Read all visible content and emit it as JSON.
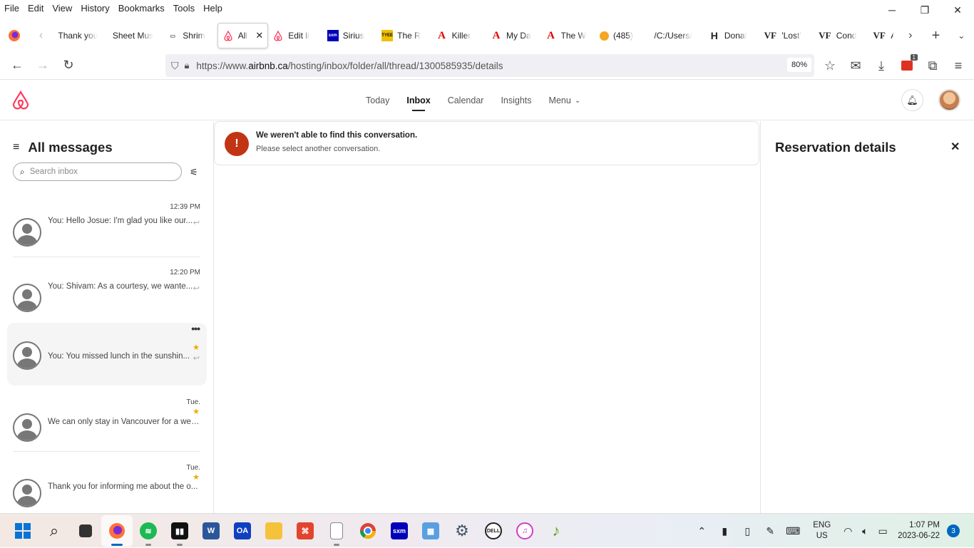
{
  "menubar": {
    "items": [
      "File",
      "Edit",
      "View",
      "History",
      "Bookmarks",
      "Tools",
      "Help"
    ]
  },
  "tabs": [
    {
      "label": "Thank you",
      "icon": "none"
    },
    {
      "label": "Sheet Mus",
      "icon": "none"
    },
    {
      "label": "Shrim",
      "icon": "site-icon"
    },
    {
      "label": "All",
      "icon": "airbnb-icon",
      "active": true
    },
    {
      "label": "Edit li",
      "icon": "airbnb-icon"
    },
    {
      "label": "Sirius",
      "icon": "sxm-icon"
    },
    {
      "label": "The R",
      "icon": "tyee-icon"
    },
    {
      "label": "Killer",
      "icon": "atlantic-icon"
    },
    {
      "label": "My Da",
      "icon": "atlantic-icon"
    },
    {
      "label": "The W",
      "icon": "atlantic-icon"
    },
    {
      "label": "(485)",
      "icon": "orange-icon"
    },
    {
      "label": "/C:/Users/",
      "icon": "none"
    },
    {
      "label": "Donal",
      "icon": "h-icon"
    },
    {
      "label": "'Lost'",
      "icon": "vf-icon"
    },
    {
      "label": "Cond",
      "icon": "vf-icon"
    },
    {
      "label": "A",
      "icon": "vf-icon"
    }
  ],
  "url": {
    "prefix": "https://www.",
    "host": "airbnb.ca",
    "path": "/hosting/inbox/folder/all/thread/1300585935/details",
    "zoom": "80%"
  },
  "extension_badge": "1",
  "site_nav": {
    "items": [
      "Today",
      "Inbox",
      "Calendar",
      "Insights",
      "Menu"
    ],
    "active": "Inbox"
  },
  "sidebar": {
    "title": "All messages",
    "search_placeholder": "Search inbox",
    "messages": [
      {
        "time": "12:39 PM",
        "text": "You: Hello Josue: I'm glad you like our...",
        "starred": false,
        "replied": true
      },
      {
        "time": "12:20 PM",
        "text": "You: Shivam: As a courtesy, we wante...",
        "starred": false,
        "replied": true
      },
      {
        "time": "",
        "text": "You: You missed lunch in the sunshin...",
        "starred": true,
        "replied": true,
        "selected": true
      },
      {
        "time": "Tue.",
        "text": "We can only stay in Vancouver for a wee...",
        "starred": true,
        "replied": false
      },
      {
        "time": "Tue.",
        "text": "Thank you for informing me about the o...",
        "starred": true,
        "replied": false
      }
    ]
  },
  "main": {
    "alert_title": "We weren't able to find this conversation.",
    "alert_body": "Please select another conversation.",
    "alert_icon": "!"
  },
  "right_panel": {
    "title": "Reservation details"
  },
  "taskbar": {
    "lang_1": "ENG",
    "lang_2": "US",
    "time": "1:07 PM",
    "date": "2023-06-22",
    "notifications": "3"
  },
  "colors": {
    "airbnb_brand": "#ff385c",
    "alert_red": "#c13515",
    "star": "#f0a800"
  }
}
